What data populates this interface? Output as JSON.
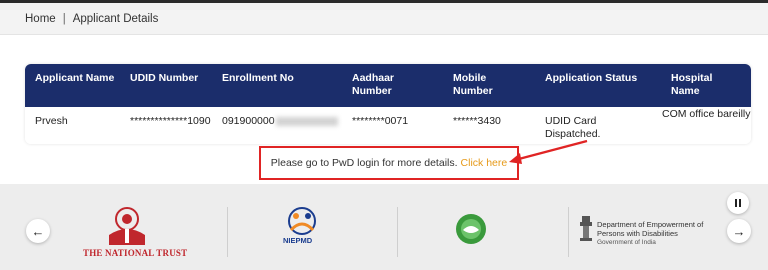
{
  "breadcrumb": {
    "home": "Home",
    "separator": "|",
    "current": "Applicant Details"
  },
  "table": {
    "headers": [
      "Applicant Name",
      "UDID Number",
      "Enrollment No",
      "Aadhaar Number",
      "Mobile Number",
      "Application Status",
      "Hospital Name"
    ],
    "row": {
      "applicant_name": "Prvesh",
      "udid_number": "**************1090",
      "enrollment_no": "091900000",
      "aadhaar_number": "********0071",
      "mobile_number": "******3430",
      "application_status": "UDID Card Dispatched.",
      "hospital_name": "COM office bareilly"
    }
  },
  "notice": {
    "text": "Please go to PwD login for more details.",
    "link": "Click here"
  },
  "partners": {
    "national_trust": "THE NATIONAL TRUST",
    "niepmd": "NIEPMD",
    "dept_line1": "Department of Empowerment of",
    "dept_line2": "Persons with Disabilities",
    "dept_line3": "Government of India"
  },
  "carousel": {
    "prev_icon": "arrow-left-icon",
    "next_icon": "arrow-right-icon",
    "pause_icon": "pause-icon"
  },
  "colors": {
    "header": "#1b2d6b",
    "highlight": "#e02424",
    "link": "#e69a1a"
  }
}
